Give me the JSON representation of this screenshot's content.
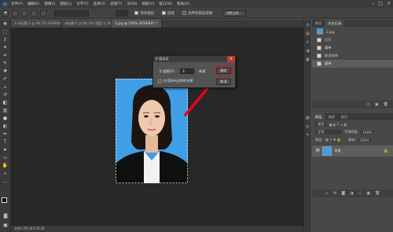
{
  "menubar": {
    "logo": "Ps",
    "items": [
      "文件(F)",
      "编辑(E)",
      "图像(I)",
      "图层(L)",
      "文字(Y)",
      "选择(S)",
      "滤镜(T)",
      "3D(D)",
      "视图(V)",
      "窗口(W)",
      "帮助(H)"
    ],
    "win_buttons": [
      "–",
      "□",
      "×"
    ]
  },
  "options": {
    "size_value": "",
    "sample_all": "消除锯齿",
    "contiguous": "连续",
    "all_layers": "对所有图层取样",
    "subtract": "调整边缘..."
  },
  "tabs": [
    {
      "label": "1-未标题-1 @ 66.7% (RGB/8#)",
      "active": false
    },
    {
      "label": "未标题-1 @ 66.7% (图层 1, RGB/8)",
      "active": false
    },
    {
      "label": "2.jpg @ 100% (RGB/8#) *",
      "active": true
    }
  ],
  "status": "文档:178.2K/178.2K",
  "dialog": {
    "title": "扩展选区",
    "label": "扩展量(E):",
    "value": "3",
    "unit": "像素",
    "ok": "确定",
    "cancel": "取消",
    "checkbox_label": "应用画布边界的效果",
    "accent": "#e8001c"
  },
  "history_panel": {
    "tabs": [
      "属性",
      "历史记录"
    ],
    "snapshot": "2.jpg",
    "items": [
      "打开",
      "魔棒",
      "取消选择",
      "魔棒"
    ],
    "selected_index": 3
  },
  "layers_panel": {
    "tabs": [
      "图层",
      "通道",
      "路径"
    ],
    "kind": "类型",
    "blend": "正常",
    "opacity_label": "不透明度:",
    "opacity": "100%",
    "lock_label": "锁定:",
    "fill_label": "填充:",
    "fill": "100%",
    "layer_name": "背景"
  },
  "colors": {
    "photo_bg": "#3f9ee6",
    "arrow": "#e8001c"
  }
}
